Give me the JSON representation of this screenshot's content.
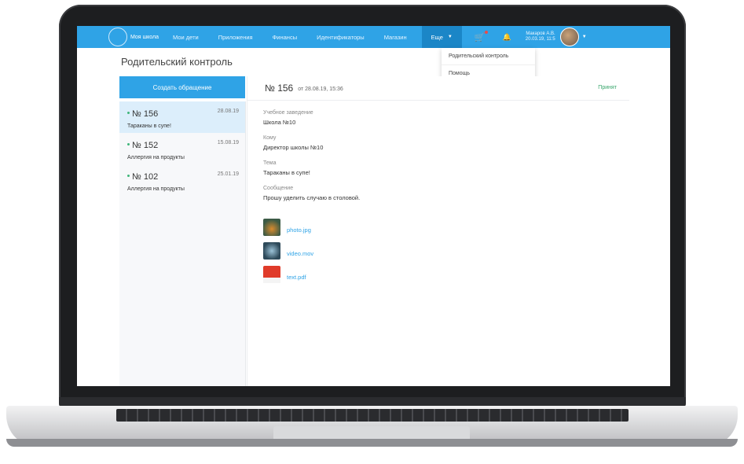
{
  "navbar": {
    "logo_text": "Моя школа",
    "items": [
      "Мои дети",
      "Приложения",
      "Финансы",
      "Идентификаторы",
      "Магазин"
    ],
    "more_label": "Еще",
    "user_name": "Макаров А.В.",
    "user_meta": "20.03.19, 11:5"
  },
  "dropdown": {
    "items": [
      "Родительский контроль",
      "Помощь"
    ]
  },
  "page": {
    "title": "Родительский контроль",
    "create_button": "Создать обращение"
  },
  "requests": [
    {
      "number": "№ 156",
      "date": "28.08.19",
      "subject": "Тараканы в супе!",
      "active": true
    },
    {
      "number": "№ 152",
      "date": "15.08.19",
      "subject": "Аллергия на продукты",
      "active": false
    },
    {
      "number": "№ 102",
      "date": "25.01.19",
      "subject": "Аллергия на продукты",
      "active": false
    }
  ],
  "detail": {
    "number": "№ 156",
    "date": "от 28.08.19, 15:36",
    "status": "Принят",
    "fields": [
      {
        "label": "Учебное заведение",
        "value": "Школа №10"
      },
      {
        "label": "Кому",
        "value": "Директор школы №10"
      },
      {
        "label": "Тема",
        "value": "Тараканы в супе!"
      },
      {
        "label": "Сообщение",
        "value": "Прошу уделить случаю в столовой."
      }
    ],
    "attachments": [
      {
        "name": "photo.jpg",
        "icon": "photo-thumbnail"
      },
      {
        "name": "video.mov",
        "icon": "video-thumbnail"
      },
      {
        "name": "text.pdf",
        "icon": "pdf-icon"
      }
    ]
  },
  "colors": {
    "accent": "#2fa3e6",
    "status_green": "#3aa76d",
    "active_row": "#dceefb"
  }
}
